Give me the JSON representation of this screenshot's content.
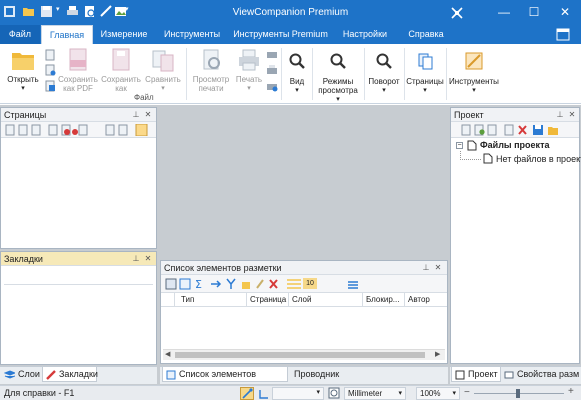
{
  "app_title": "ViewCompanion Premium",
  "window_controls": {
    "minimize": "—",
    "maximize": "☐",
    "close": "✕"
  },
  "menu_tabs": [
    {
      "label": "Файл"
    },
    {
      "label": "Главная"
    },
    {
      "label": "Измерение"
    },
    {
      "label": "Инструменты"
    },
    {
      "label": "Инструменты Premium"
    },
    {
      "label": "Настройки"
    },
    {
      "label": "Справка"
    }
  ],
  "ribbon": {
    "open": "Открыть",
    "save_pdf": "Сохранить\nкак PDF",
    "save_as": "Сохранить\nкак",
    "compare": "Сравнить",
    "print_preview": "Просмотр\nпечати",
    "print": "Печать",
    "view": "Вид",
    "view_modes": "Режимы\nпросмотра",
    "rotate": "Поворот",
    "pages": "Страницы",
    "tools": "Инструменты",
    "group_file": "Файл"
  },
  "pages_panel": {
    "title": "Страницы"
  },
  "bookmarks_panel": {
    "title": "Закладки"
  },
  "left_tabs": {
    "layers": "Слои",
    "bookmarks": "Закладки"
  },
  "markup_panel": {
    "title": "Список элементов разметки",
    "columns": [
      "Тип",
      "Страница",
      "Слой",
      "Блокир...",
      "Автор"
    ],
    "counter": "10"
  },
  "bottom_tabs": {
    "markup_list": "Список элементов разметки",
    "explorer": "Проводник"
  },
  "project_panel": {
    "title": "Проект",
    "root": "Файлы проекта",
    "empty": "Нет файлов в проекте"
  },
  "right_tabs": {
    "project": "Проект",
    "properties": "Свойства разм..."
  },
  "status": {
    "help": "Для справки - F1",
    "units": "Millimeter",
    "zoom": "100%"
  },
  "colors": {
    "accent": "#1e73c8",
    "accent_dark": "#1565b7",
    "bookmark_header": "#f6e9b8"
  }
}
